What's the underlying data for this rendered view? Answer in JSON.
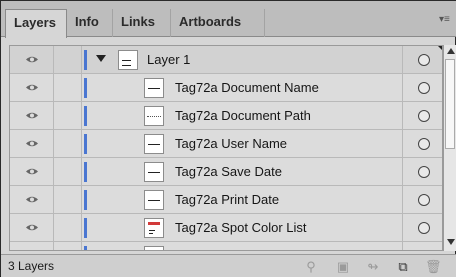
{
  "tabs": [
    "Layers",
    "Info",
    "Links",
    "Artboards"
  ],
  "panel_menu_icon": "panel-menu-icon",
  "parent_layer": {
    "name": "Layer 1"
  },
  "items": [
    {
      "name": "Tag72a Document Name",
      "thumb": "line"
    },
    {
      "name": "Tag72a Document Path",
      "thumb": "dotted"
    },
    {
      "name": "Tag72a User Name",
      "thumb": "line"
    },
    {
      "name": "Tag72a Save Date",
      "thumb": "line"
    },
    {
      "name": "Tag72a Print Date",
      "thumb": "line"
    },
    {
      "name": "Tag72a Spot Color List",
      "thumb": "color-list"
    },
    {
      "name": "",
      "thumb": "red"
    }
  ],
  "footer": {
    "count": "3 Layers",
    "icons": [
      "search-icon",
      "make-clip-mask-icon",
      "create-sublayer-icon",
      "new-layer-icon",
      "trash-icon"
    ]
  },
  "colors": {
    "layer_color": "#4a76d1"
  }
}
